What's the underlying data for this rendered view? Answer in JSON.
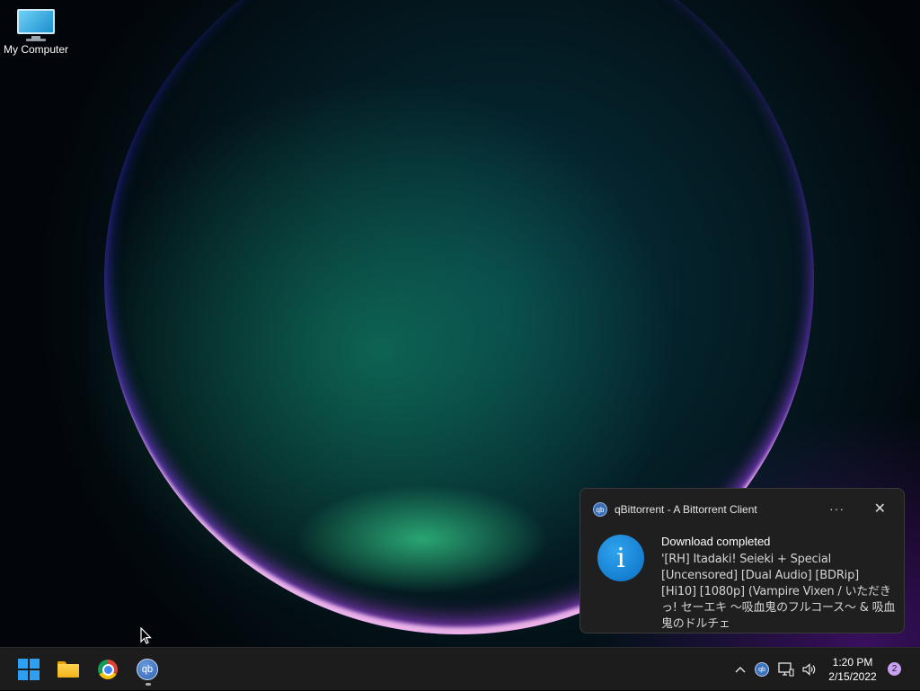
{
  "desktop": {
    "icons": [
      {
        "label": "My Computer",
        "icon": "monitor-icon"
      }
    ]
  },
  "notification": {
    "app_name": "qBittorrent - A Bittorrent Client",
    "app_icon_text": "qb",
    "more_label": "···",
    "close_label": "✕",
    "info_icon_text": "i",
    "title": "Download completed",
    "body": "'[RH] Itadaki! Seieki + Special [Uncensored] [Dual Audio] [BDRip] [Hi10] [1080p] (Vampire Vixen / いただきっ! セーエキ ～吸血鬼のフルコース～ & 吸血鬼のドルチェ"
  },
  "taskbar": {
    "apps": [
      {
        "name": "Start",
        "icon": "windows-logo-icon"
      },
      {
        "name": "File Explorer",
        "icon": "folder-icon"
      },
      {
        "name": "Google Chrome",
        "icon": "chrome-icon"
      },
      {
        "name": "qBittorrent",
        "icon": "qbittorrent-icon",
        "text": "qb"
      }
    ],
    "tray": {
      "overflow_glyph": "^",
      "qb_text": "qb",
      "volume_glyph": "🔊",
      "time": "1:20 PM",
      "date": "2/15/2022",
      "notification_count": "2"
    }
  },
  "colors": {
    "taskbar_bg": "#1c1c1c",
    "toast_bg": "#1f1f1f",
    "accent": "#2f9ff1"
  }
}
